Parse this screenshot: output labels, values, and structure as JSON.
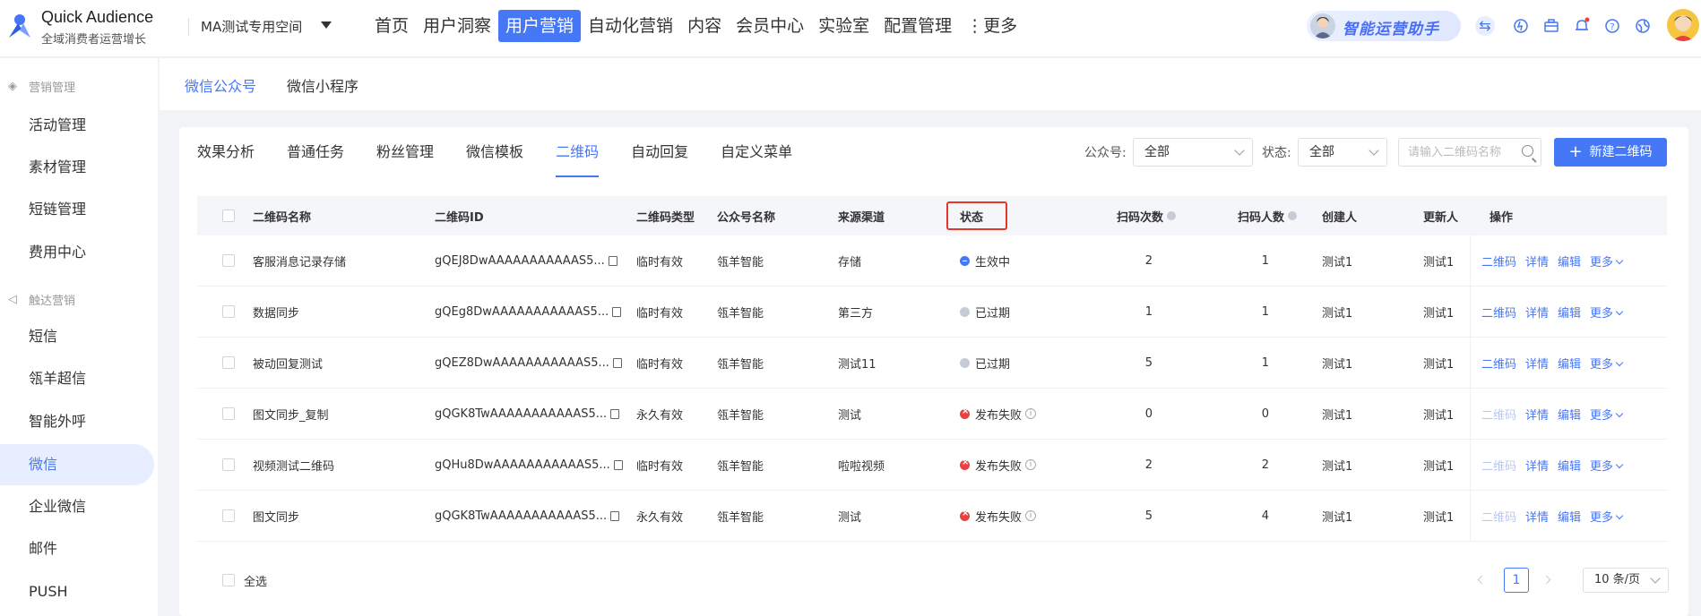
{
  "brand": {
    "title": "Quick Audience",
    "subtitle": "全域消费者运营增长"
  },
  "workspace": "MA测试专用空间",
  "nav": [
    "首页",
    "用户洞察",
    "用户营销",
    "自动化营销",
    "内容",
    "会员中心",
    "实验室",
    "配置管理",
    "⋮更多"
  ],
  "nav_active": 2,
  "assistant": "智能运营助手",
  "sidebar": {
    "group1": "营销管理",
    "group1_items": [
      "活动管理",
      "素材管理",
      "短链管理",
      "费用中心"
    ],
    "group2": "触达营销",
    "group2_items": [
      "短信",
      "瓴羊超信",
      "智能外呼",
      "微信",
      "企业微信",
      "邮件",
      "PUSH"
    ],
    "active": "微信"
  },
  "subtabs": [
    "微信公众号",
    "微信小程序"
  ],
  "tabs": [
    "效果分析",
    "普通任务",
    "粉丝管理",
    "微信模板",
    "二维码",
    "自动回复",
    "自定义菜单"
  ],
  "filters": {
    "account_label": "公众号:",
    "account_value": "全部",
    "status_label": "状态:",
    "status_value": "全部",
    "search_placeholder": "请输入二维码名称",
    "new_button": "新建二维码"
  },
  "table": {
    "headers": [
      "二维码名称",
      "二维码ID",
      "二维码类型",
      "公众号名称",
      "来源渠道",
      "状态",
      "扫码次数",
      "扫码人数",
      "创建人",
      "更新人",
      "操作"
    ],
    "rows": [
      {
        "name": "客服消息记录存储",
        "id": "gQEJ8DwAAAAAAAAAAAS5...",
        "type": "临时有效",
        "account": "瓴羊智能",
        "channel": "存储",
        "status": "生效中",
        "status_kind": "active",
        "scans": "2",
        "users": "1",
        "creator": "测试1",
        "updater": "测试1"
      },
      {
        "name": "数据同步",
        "id": "gQEg8DwAAAAAAAAAAAS5...",
        "type": "临时有效",
        "account": "瓴羊智能",
        "channel": "第三方",
        "status": "已过期",
        "status_kind": "expired",
        "scans": "1",
        "users": "1",
        "creator": "测试1",
        "updater": "测试1"
      },
      {
        "name": "被动回复测试",
        "id": "gQEZ8DwAAAAAAAAAAAS5...",
        "type": "临时有效",
        "account": "瓴羊智能",
        "channel": "测试11",
        "status": "已过期",
        "status_kind": "expired",
        "scans": "5",
        "users": "1",
        "creator": "测试1",
        "updater": "测试1"
      },
      {
        "name": "图文同步_复制",
        "id": "gQGK8TwAAAAAAAAAAAS5...",
        "type": "永久有效",
        "account": "瓴羊智能",
        "channel": "测试",
        "status": "发布失败",
        "status_kind": "fail",
        "scans": "0",
        "users": "0",
        "creator": "测试1",
        "updater": "测试1"
      },
      {
        "name": "视频测试二维码",
        "id": "gQHu8DwAAAAAAAAAAAS5...",
        "type": "临时有效",
        "account": "瓴羊智能",
        "channel": "啦啦视频",
        "status": "发布失败",
        "status_kind": "fail",
        "scans": "2",
        "users": "2",
        "creator": "测试1",
        "updater": "测试1"
      },
      {
        "name": "图文同步",
        "id": "gQGK8TwAAAAAAAAAAAS5...",
        "type": "永久有效",
        "account": "瓴羊智能",
        "channel": "测试",
        "status": "发布失败",
        "status_kind": "fail",
        "scans": "5",
        "users": "4",
        "creator": "测试1",
        "updater": "测试1"
      }
    ],
    "ops": [
      "二维码",
      "详情",
      "编辑",
      "更多"
    ]
  },
  "footer": {
    "select_all": "全选",
    "page": "1",
    "page_size": "10 条/页"
  },
  "colors": {
    "accent": "#4677f6",
    "danger": "#e84141",
    "highlight": "#e8352a"
  }
}
